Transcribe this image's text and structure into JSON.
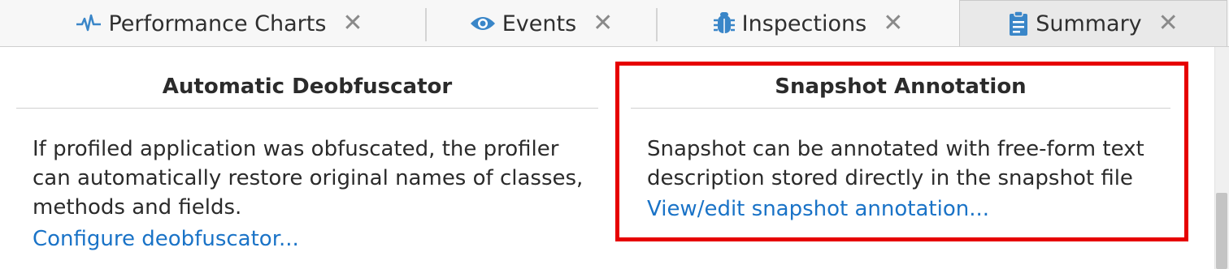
{
  "tabs": [
    {
      "label": "Performance Charts",
      "icon": "pulse-icon",
      "active": false
    },
    {
      "label": "Events",
      "icon": "eye-icon",
      "active": false
    },
    {
      "label": "Inspections",
      "icon": "bug-icon",
      "active": false
    },
    {
      "label": "Summary",
      "icon": "clipboard-icon",
      "active": true
    }
  ],
  "close_glyph": "✕",
  "left_panel": {
    "title": "Automatic Deobfuscator",
    "description": "If profiled application was obfuscated, the profiler\ncan automatically restore original names of classes,\nmethods and fields.",
    "link": "Configure deobfuscator..."
  },
  "right_panel": {
    "title": "Snapshot Annotation",
    "description": "Snapshot can be annotated with free-form text\ndescription stored directly in the snapshot file",
    "link": "View/edit snapshot annotation..."
  },
  "colors": {
    "accent_icon": "#3a86c8",
    "link": "#1a73c7",
    "highlight": "#e60000"
  }
}
